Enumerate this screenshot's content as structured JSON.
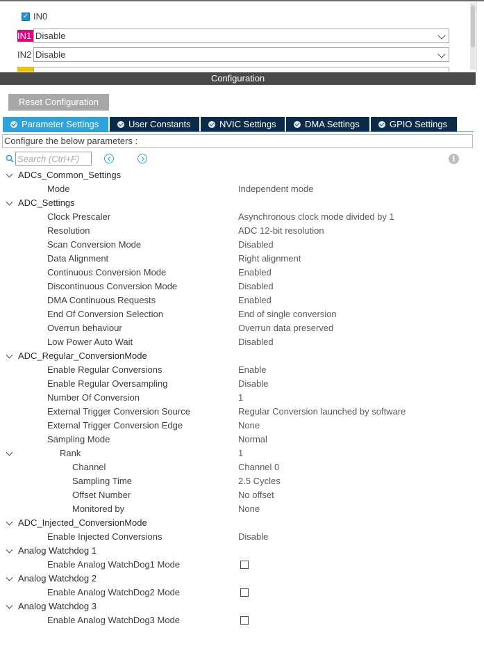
{
  "top_panel": {
    "in0": {
      "label": "IN0",
      "checked": true
    },
    "in1": {
      "label": "IN1",
      "value": "Disable",
      "highlight_color": "#e6007e"
    },
    "in2": {
      "label": "IN2",
      "value": "Disable"
    },
    "partial_label_color": "#f2c200"
  },
  "config_header": "Configuration",
  "reset_button": "Reset Configuration",
  "tabs": [
    {
      "label": "Parameter Settings",
      "active": true
    },
    {
      "label": "User Constants",
      "active": false
    },
    {
      "label": "NVIC Settings",
      "active": false
    },
    {
      "label": "DMA Settings",
      "active": false
    },
    {
      "label": "GPIO Settings",
      "active": false
    }
  ],
  "configure_text": "Configure the below parameters :",
  "search": {
    "placeholder": "Search (Ctrl+F)"
  },
  "icons": {
    "search": "search-icon",
    "prev": "chevron-left-circle-icon",
    "next": "chevron-right-circle-icon",
    "info": "info-icon",
    "info_glyph": "i"
  },
  "colors": {
    "tab_active": "#2fa3d9",
    "tab_inactive": "#0c2b48",
    "header_bg": "#494949",
    "reset_bg": "#a8a8a8"
  },
  "tree": [
    {
      "type": "group",
      "label": "ADCs_Common_Settings"
    },
    {
      "type": "param",
      "level": 1,
      "label": "Mode",
      "value": "Independent mode"
    },
    {
      "type": "group",
      "label": "ADC_Settings"
    },
    {
      "type": "param",
      "level": 1,
      "label": "Clock Prescaler",
      "value": "Asynchronous clock mode divided by 1"
    },
    {
      "type": "param",
      "level": 1,
      "label": "Resolution",
      "value": "ADC 12-bit resolution"
    },
    {
      "type": "param",
      "level": 1,
      "label": "Scan Conversion Mode",
      "value": "Disabled"
    },
    {
      "type": "param",
      "level": 1,
      "label": "Data Alignment",
      "value": "Right alignment"
    },
    {
      "type": "param",
      "level": 1,
      "label": "Continuous Conversion Mode",
      "value": "Enabled"
    },
    {
      "type": "param",
      "level": 1,
      "label": "Discontinuous Conversion Mode",
      "value": "Disabled"
    },
    {
      "type": "param",
      "level": 1,
      "label": "DMA Continuous Requests",
      "value": "Enabled"
    },
    {
      "type": "param",
      "level": 1,
      "label": "End Of Conversion Selection",
      "value": "End of single conversion"
    },
    {
      "type": "param",
      "level": 1,
      "label": "Overrun behaviour",
      "value": "Overrun data preserved"
    },
    {
      "type": "param",
      "level": 1,
      "label": "Low Power Auto Wait",
      "value": "Disabled"
    },
    {
      "type": "group",
      "label": "ADC_Regular_ConversionMode"
    },
    {
      "type": "param",
      "level": 1,
      "label": "Enable Regular Conversions",
      "value": "Enable"
    },
    {
      "type": "param",
      "level": 1,
      "label": "Enable Regular Oversampling",
      "value": "Disable"
    },
    {
      "type": "param",
      "level": 1,
      "label": "Number Of Conversion",
      "value": "1"
    },
    {
      "type": "param",
      "level": 1,
      "label": "External Trigger Conversion Source",
      "value": "Regular Conversion launched by software"
    },
    {
      "type": "param",
      "level": 1,
      "label": "External Trigger Conversion Edge",
      "value": "None"
    },
    {
      "type": "param",
      "level": 1,
      "label": "Sampling Mode",
      "value": "Normal"
    },
    {
      "type": "subgroup",
      "level": 2,
      "label": "Rank",
      "value": "1"
    },
    {
      "type": "param",
      "level": 3,
      "label": "Channel",
      "value": "Channel 0"
    },
    {
      "type": "param",
      "level": 3,
      "label": "Sampling Time",
      "value": "2.5 Cycles"
    },
    {
      "type": "param",
      "level": 3,
      "label": "Offset Number",
      "value": "No offset"
    },
    {
      "type": "param",
      "level": 3,
      "label": "Monitored by",
      "value": "None"
    },
    {
      "type": "group",
      "label": "ADC_Injected_ConversionMode"
    },
    {
      "type": "param",
      "level": 1,
      "label": "Enable Injected Conversions",
      "value": "Disable"
    },
    {
      "type": "group",
      "label": "Analog Watchdog 1"
    },
    {
      "type": "checkbox",
      "level": 1,
      "label": "Enable Analog WatchDog1 Mode",
      "checked": false
    },
    {
      "type": "group",
      "label": "Analog Watchdog 2"
    },
    {
      "type": "checkbox",
      "level": 1,
      "label": "Enable Analog WatchDog2 Mode",
      "checked": false
    },
    {
      "type": "group",
      "label": "Analog Watchdog 3"
    },
    {
      "type": "checkbox",
      "level": 1,
      "label": "Enable Analog WatchDog3 Mode",
      "checked": false
    }
  ]
}
